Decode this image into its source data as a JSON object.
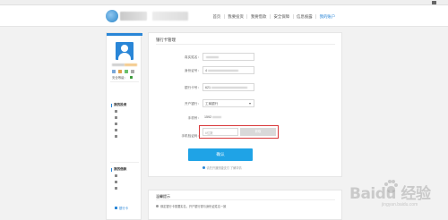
{
  "topbar": {
    "links": [
      "",
      "",
      "",
      "",
      ""
    ]
  },
  "nav": {
    "items": [
      "首页",
      "我要投资",
      "我要借款",
      "安全保障",
      "信息披露",
      "我的账户"
    ],
    "active_index": 5
  },
  "sidebar": {
    "safety_label": "安全等级：",
    "sections": [
      {
        "title": "我的投资",
        "items": [
          "",
          "",
          "",
          "",
          ""
        ]
      },
      {
        "title": "我的借款",
        "items": [
          "",
          "",
          "",
          "银行卡"
        ]
      }
    ],
    "active_item": "银行卡"
  },
  "main": {
    "title": "银行卡管理",
    "fields": [
      {
        "label": "真实姓名：",
        "value": ""
      },
      {
        "label": "身份证号：",
        "value": "4"
      },
      {
        "label": "银行卡号：",
        "value": "621"
      },
      {
        "label": "开户银行：",
        "value": "工商银行"
      },
      {
        "label": "手机号：",
        "value": "1592"
      },
      {
        "label": "手机验证码：",
        "value": "",
        "placeholder": "6位数"
      }
    ],
    "vcode_button": "获取",
    "confirm_button": "确认",
    "tip_note": "请先开通快捷支付 了解详情"
  },
  "tips": {
    "title": "温馨提示",
    "line1": "绑定银行卡需要实名，开户银行需与身份证姓名一致"
  },
  "watermark": {
    "text": "Baidu 经验",
    "sub": "jingyan.baidu.com"
  },
  "colors": {
    "accent": "#2a86d7",
    "confirm": "#1fa3e6",
    "highlight": "#d9383a"
  }
}
